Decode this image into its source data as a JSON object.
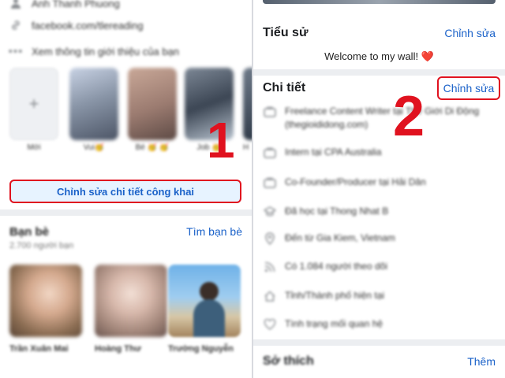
{
  "left": {
    "info_rows": [
      {
        "icon": "person-icon",
        "text": "Anh Thanh Phuong"
      },
      {
        "icon": "link-icon",
        "text": "facebook.com/tlereading"
      },
      {
        "icon": "ellipsis-icon",
        "text": "Xem thông tin giới thiệu của bạn"
      }
    ],
    "highlights": {
      "new_label": "Mới",
      "items": [
        "Vui🥳",
        "Bé 🥳 🥳",
        "Job 🥳"
      ],
      "partial_label": "H"
    },
    "edit_public_button": "Chỉnh sửa chi tiết công khai",
    "friends": {
      "title": "Bạn bè",
      "count": "2.700 người bạn",
      "find_link": "Tìm bạn bè",
      "names": [
        "Trần Xuân Mai",
        "Hoàng Thư",
        "Trường Nguyễn"
      ]
    }
  },
  "right": {
    "bio": {
      "title": "Tiểu sử",
      "edit_link": "Chỉnh sửa",
      "text": "Welcome to my wall!",
      "heart": "❤️"
    },
    "details": {
      "title": "Chi tiết",
      "edit_link": "Chỉnh sửa",
      "rows": [
        {
          "icon": "briefcase-icon",
          "text": "Freelance Content Writer tại Thế Giới Di Động (thegioididong.com)"
        },
        {
          "icon": "briefcase-icon",
          "text": "Intern tại CPA Australia"
        },
        {
          "icon": "briefcase-icon",
          "text": "Co-Founder/Producer tại Hải Dân"
        },
        {
          "icon": "graduation-cap-icon",
          "text": "Đã học tại Thong Nhat B"
        },
        {
          "icon": "location-pin-icon",
          "text": "Đến từ Gia Kiem, Vietnam"
        },
        {
          "icon": "rss-icon",
          "text": "Có 1.084 người theo dõi"
        },
        {
          "icon": "home-icon",
          "text": "Tỉnh/Thành phố hiện tại"
        },
        {
          "icon": "heart-outline-icon",
          "text": "Tình trạng mối quan hệ"
        }
      ]
    },
    "hobbies": {
      "title": "Sở thích",
      "more_link": "Thêm"
    }
  },
  "markers": {
    "one": "1",
    "two": "2"
  },
  "colors": {
    "accent_blue": "#1b62c9",
    "highlight_red": "#e0121f",
    "button_bg": "#e7f3ff"
  }
}
